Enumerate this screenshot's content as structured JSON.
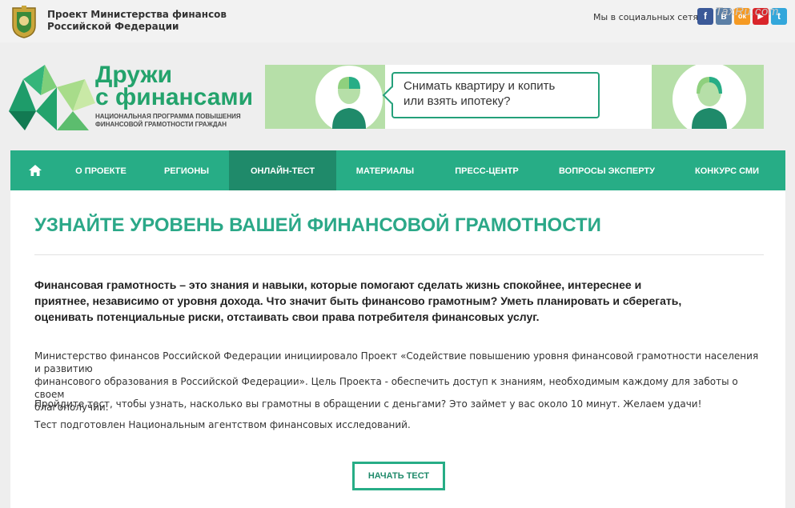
{
  "header": {
    "ministry_line1": "Проект Министерства финансов",
    "ministry_line2": "Российской Федерации",
    "social_label": "Мы в социальных сетях:",
    "social": [
      {
        "icon": "facebook-icon",
        "glyph": "f",
        "color": "#3b5998"
      },
      {
        "icon": "vk-icon",
        "glyph": "в",
        "color": "#5b7fa6"
      },
      {
        "icon": "odnoklassniki-icon",
        "glyph": "ок",
        "color": "#f59a23"
      },
      {
        "icon": "youtube-icon",
        "glyph": "▶",
        "color": "#d9252a"
      },
      {
        "icon": "twitter-icon",
        "glyph": "t",
        "color": "#33a7db"
      }
    ],
    "watermark": "TaxRu.com"
  },
  "logo": {
    "title_line1": "Дружи",
    "title_line2": "с финансами",
    "subtitle_line1": "НАЦИОНАЛЬНАЯ ПРОГРАММА ПОВЫШЕНИЯ",
    "subtitle_line2": "ФИНАНСОВОЙ ГРАМОТНОСТИ ГРАЖДАН"
  },
  "banner": {
    "line1": "Снимать квартиру и копить",
    "line2": "или взять ипотеку?"
  },
  "nav": {
    "items": [
      {
        "label": "О ПРОЕКТЕ"
      },
      {
        "label": "РЕГИОНЫ"
      },
      {
        "label": "ОНЛАЙН-ТЕСТ"
      },
      {
        "label": "МАТЕРИАЛЫ"
      },
      {
        "label": "ПРЕСС-ЦЕНТР"
      },
      {
        "label": "ВОПРОСЫ ЭКСПЕРТУ"
      },
      {
        "label": "КОНКУРС СМИ"
      }
    ],
    "active": "ОНЛАЙН-ТЕСТ"
  },
  "main": {
    "title": "УЗНАЙТЕ УРОВЕНЬ ВАШЕЙ ФИНАНСОВОЙ ГРАМОТНОСТИ",
    "lead_line1": "Финансовая грамотность – это знания и навыки, которые помогают сделать жизнь спокойнее, интереснее и",
    "lead_line2": "приятнее, независимо от уровня дохода.  Что значит быть финансово грамотным? Уметь планировать и сберегать,",
    "lead_line3": "оценивать потенциальные риски, отстаивать свои права потребителя финансовых услуг.",
    "para1_line1": "Министерство финансов Российской Федерации инициировало Проект «Содействие повышению уровня финансовой грамотности населения и развитию",
    "para1_line2": "финансового образования в Российской Федерации». Цель Проекта - обеспечить доступ к знаниям, необходимым каждому для заботы о своем",
    "para1_line3": "благополучии.",
    "para2": "Пройдите тест, чтобы узнать, насколько вы грамотны в обращении с деньгами? Это займет у вас около 10 минут. Желаем удачи!",
    "para3": "Тест подготовлен Национальным агентством финансовых исследований.",
    "start_button": "НАЧАТЬ ТЕСТ"
  },
  "colors": {
    "accent": "#27ad86",
    "accent_dark": "#1f8a6a",
    "logo_green": "#23a36c"
  }
}
